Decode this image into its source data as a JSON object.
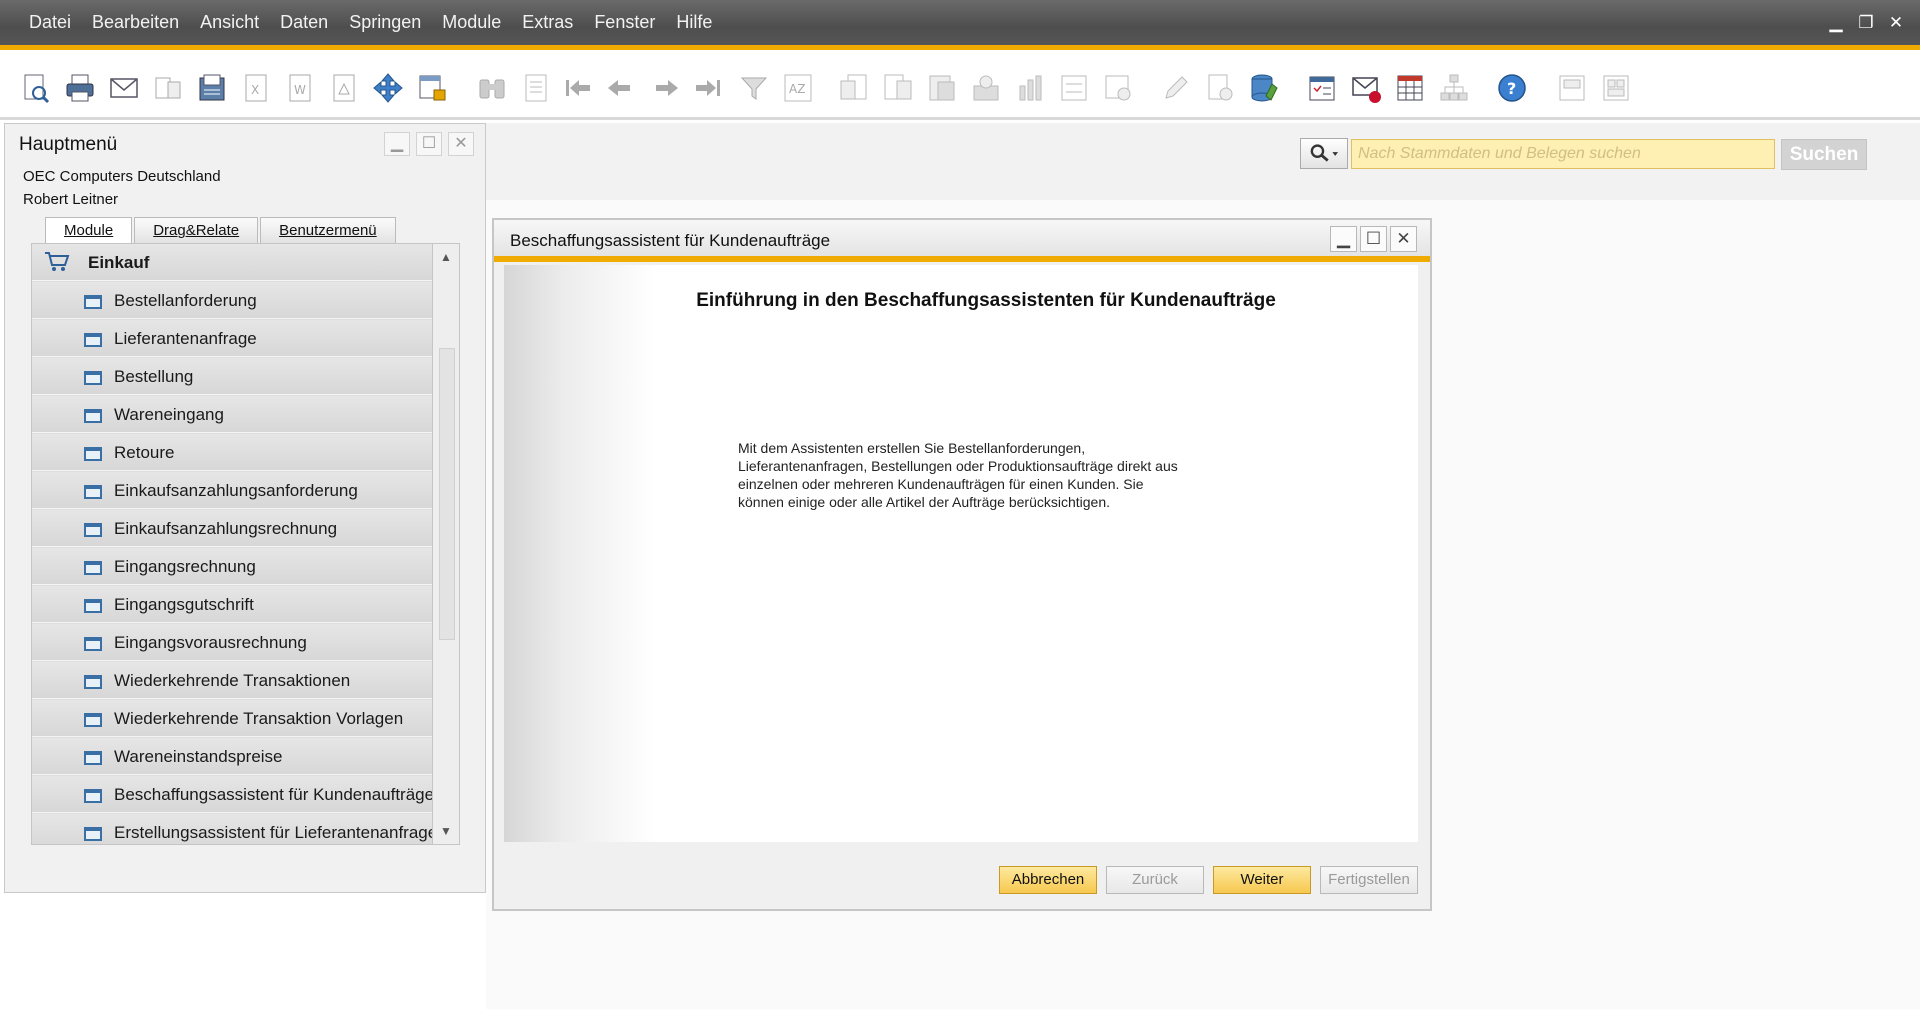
{
  "menubar": {
    "items": [
      "Datei",
      "Bearbeiten",
      "Ansicht",
      "Daten",
      "Springen",
      "Module",
      "Extras",
      "Fenster",
      "Hilfe"
    ]
  },
  "toolbar": {
    "icons": [
      "preview-icon",
      "print-icon",
      "email-icon",
      "export-icon",
      "fax-icon",
      "excel-icon",
      "word-icon",
      "pdf-icon",
      "move-icon",
      "lock-icon",
      "binoculars-icon",
      "form-icon",
      "first-record-icon",
      "previous-record-icon",
      "next-record-icon",
      "last-record-icon",
      "filter-icon",
      "sort-icon",
      "copy-from-icon",
      "copy-to-icon",
      "table-icon",
      "gross-profit-icon",
      "cashflow-icon",
      "settings-icon",
      "document-settings-icon",
      "edit-icon",
      "approval-icon",
      "database-icon",
      "calendar-icon",
      "message-icon",
      "spreadsheet-icon",
      "hierarchy-icon",
      "help-icon",
      "widget-icon",
      "dashboard-icon"
    ]
  },
  "search": {
    "placeholder": "Nach Stammdaten und Belegen suchen",
    "button": "Suchen"
  },
  "main_menu": {
    "title": "Hauptmenü",
    "company": "OEC Computers Deutschland",
    "user": "Robert Leitner",
    "tabs": [
      "Module",
      "Drag&Relate",
      "Benutzermenü"
    ],
    "section": "Einkauf",
    "items": [
      "Bestellanforderung",
      "Lieferantenanfrage",
      "Bestellung",
      "Wareneingang",
      "Retoure",
      "Einkaufsanzahlungsanforderung",
      "Einkaufsanzahlungsrechnung",
      "Eingangsrechnung",
      "Eingangsgutschrift",
      "Eingangsvorausrechnung",
      "Wiederkehrende Transaktionen",
      "Wiederkehrende Transaktion Vorlagen",
      "Wareneinstandspreise",
      "Beschaffungsassistent für Kundenaufträge",
      "Erstellungsassistent für Lieferantenanfragen"
    ]
  },
  "wizard": {
    "title": "Beschaffungsassistent für Kundenaufträge",
    "heading": "Einführung in den Beschaffungsassistenten für Kundenaufträge",
    "body": "Mit dem Assistenten erstellen Sie Bestellanforderungen, Lieferantenanfragen, Bestellungen oder Produktionsaufträge direkt aus einzelnen oder mehreren Kundenaufträgen für einen Kunden. Sie können einige oder alle Artikel der Aufträge berücksichtigen.",
    "buttons": {
      "cancel": "Abbrechen",
      "back": "Zurück",
      "next": "Weiter",
      "finish": "Fertigstellen"
    }
  },
  "colors": {
    "accent": "#f0ab00",
    "search_bg": "#fdf0b2"
  }
}
